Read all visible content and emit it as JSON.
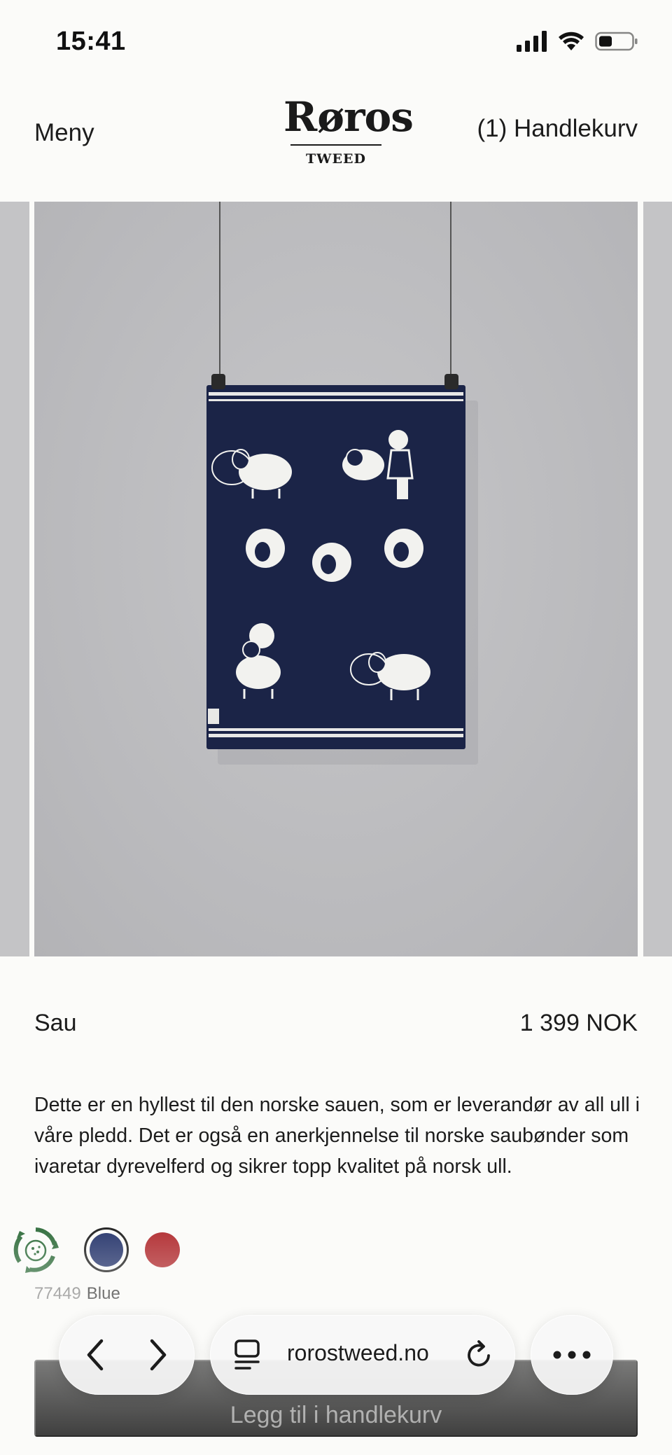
{
  "status": {
    "time": "15:41"
  },
  "header": {
    "menu_label": "Meny",
    "logo_word": "Røros",
    "logo_sub": "TWEED",
    "cart_label": "(1) Handlekurv"
  },
  "product": {
    "name": "Sau",
    "price": "1 399 NOK",
    "description": "Dette er en hyllest til den norske sauen, som er leverandør av all ull i våre pledd. Det er også en anerkjennelse til norske saubønder som ivaretar dyrevelferd og sikrer topp kvalitet på norsk ull."
  },
  "variants": {
    "swatches": [
      {
        "name": "Blue",
        "color": "#25346b",
        "selected": true
      },
      {
        "name": "Red",
        "color": "#b02a2e",
        "selected": false
      }
    ],
    "selected_code": "77449",
    "selected_name": "Blue"
  },
  "add_to_cart_label": "Legg til i handlekurv",
  "browser": {
    "url": "rorostweed.no",
    "icons": [
      "back-icon",
      "forward-icon",
      "tabs-icon",
      "reload-icon",
      "more-icon"
    ]
  },
  "colors": {
    "background": "#fbfbf9",
    "blanket": "#1b2447",
    "button": "#1a1a1a",
    "eco_green": "#2e6b3a"
  }
}
